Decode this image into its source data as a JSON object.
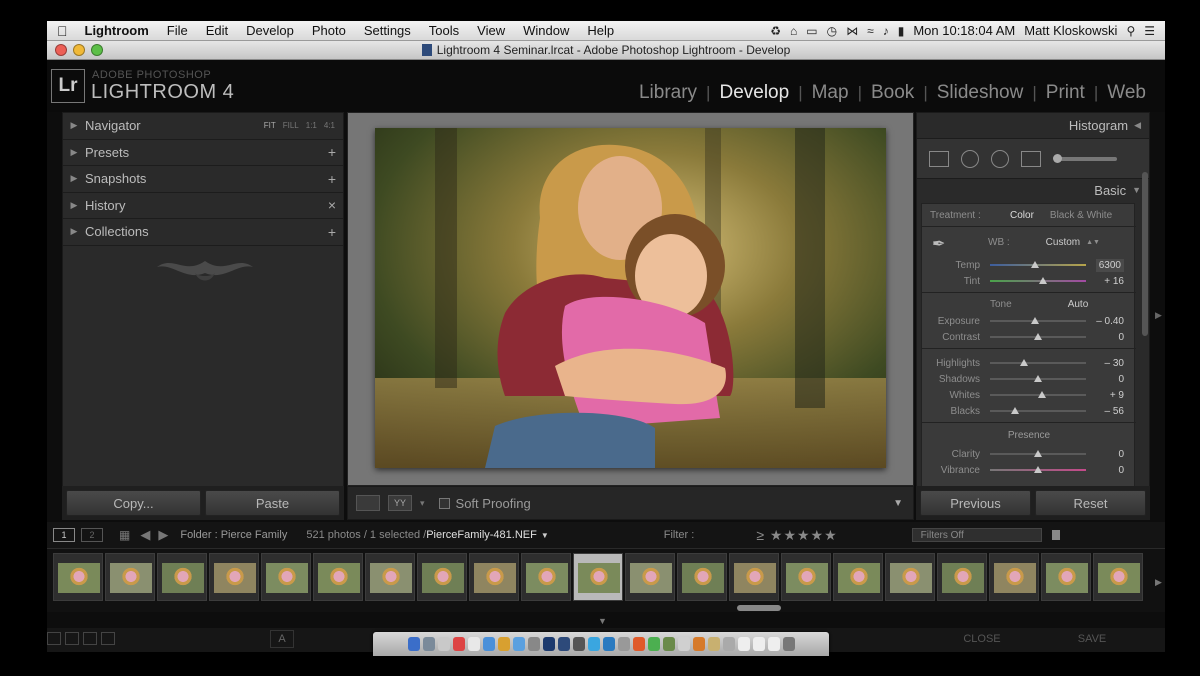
{
  "menubar": {
    "app_name": "Lightroom",
    "menus": [
      "File",
      "Edit",
      "Develop",
      "Photo",
      "Settings",
      "Tools",
      "View",
      "Window",
      "Help"
    ],
    "clock": "Mon 10:18:04 AM",
    "user": "Matt Kloskowski"
  },
  "window": {
    "title": "Lightroom 4 Seminar.lrcat - Adobe Photoshop Lightroom - Develop"
  },
  "lr": {
    "logo": "Lr",
    "brand_top": "ADOBE PHOTOSHOP",
    "brand_main": "LIGHTROOM 4",
    "modules": [
      "Library",
      "Develop",
      "Map",
      "Book",
      "Slideshow",
      "Print",
      "Web"
    ],
    "active_module": "Develop"
  },
  "left_panel": {
    "navigator": "Navigator",
    "zoom_options": [
      "FIT",
      "FILL",
      "1:1",
      "4:1"
    ],
    "presets": "Presets",
    "snapshots": "Snapshots",
    "history": "History",
    "collections": "Collections",
    "copy_button": "Copy...",
    "paste_button": "Paste"
  },
  "toolbar": {
    "soft_proofing": "Soft Proofing"
  },
  "right_panel": {
    "histogram": "Histogram",
    "basic": "Basic",
    "treatment_label": "Treatment :",
    "treatment_color": "Color",
    "treatment_bw": "Black & White",
    "wb_label": "WB :",
    "wb_value": "Custom",
    "temp_label": "Temp",
    "temp_value": "6300",
    "tint_label": "Tint",
    "tint_value": "+ 16",
    "tone_label": "Tone",
    "auto_label": "Auto",
    "exposure_label": "Exposure",
    "exposure_value": "– 0.40",
    "contrast_label": "Contrast",
    "contrast_value": "0",
    "highlights_label": "Highlights",
    "highlights_value": "– 30",
    "shadows_label": "Shadows",
    "shadows_value": "0",
    "whites_label": "Whites",
    "whites_value": "+ 9",
    "blacks_label": "Blacks",
    "blacks_value": "– 56",
    "presence_label": "Presence",
    "clarity_label": "Clarity",
    "clarity_value": "0",
    "vibrance_label": "Vibrance",
    "vibrance_value": "0",
    "previous_button": "Previous",
    "reset_button": "Reset",
    "slider_levels": {
      "temp": 0.47,
      "tint": 0.55,
      "exposure": 0.47,
      "contrast": 0.5,
      "highlights": 0.35,
      "shadows": 0.5,
      "whites": 0.54,
      "blacks": 0.26,
      "clarity": 0.5,
      "vibrance": 0.5
    }
  },
  "filmstrip": {
    "monitor_1": "1",
    "monitor_2": "2",
    "folder": "Folder : Pierce Family",
    "count": "521 photos / 1 selected /",
    "file": "PierceFamily-481.NEF",
    "filter_label": "Filter :",
    "stars": "≥ ★★★★★",
    "filters_dropdown": "Filters Off",
    "thumbnails": 21,
    "selected_index": 10
  },
  "bottom": {
    "letter": "A",
    "close": "CLOSE",
    "save": "SAVE"
  },
  "colors": {
    "accent": "#e6e6e6",
    "panel": "#2a2a2a",
    "traffic_close": "#ec5f56",
    "traffic_min": "#f0b938",
    "traffic_max": "#5cbf48"
  }
}
